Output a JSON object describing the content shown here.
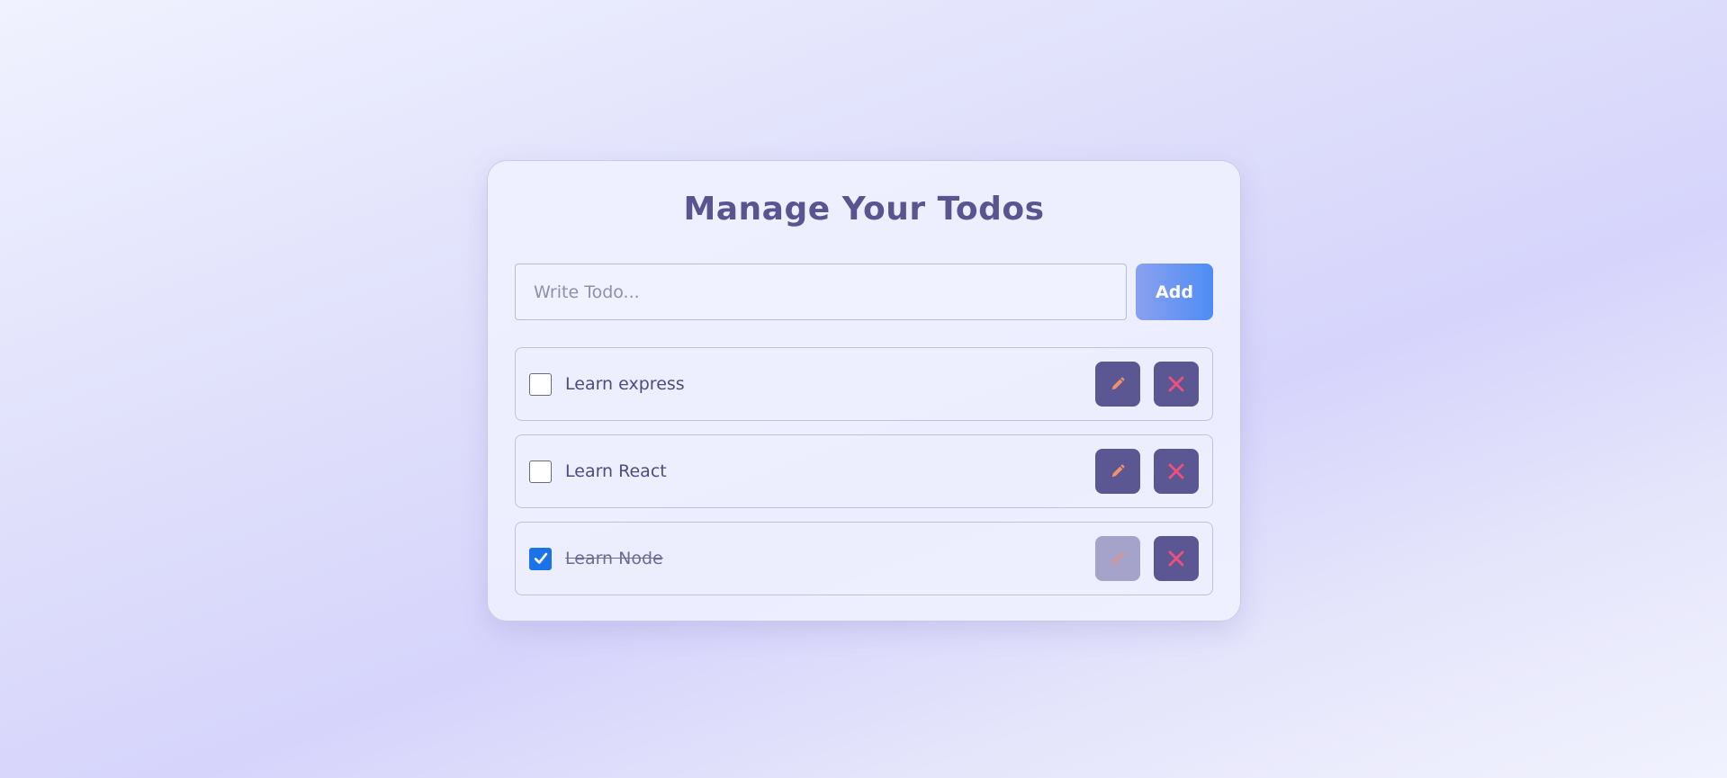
{
  "title": "Manage Your Todos",
  "input": {
    "placeholder": "Write Todo...",
    "value": ""
  },
  "add_label": "Add",
  "todos": [
    {
      "text": "Learn express",
      "completed": false
    },
    {
      "text": "Learn React",
      "completed": false
    },
    {
      "text": "Learn Node",
      "completed": true
    }
  ],
  "icons": {
    "edit": "pencil-icon",
    "delete": "close-icon",
    "checked": "checkmark-icon"
  },
  "colors": {
    "accent": "#5b5792",
    "edit_icon": "#f2906a",
    "delete_icon": "#f0507e",
    "checkbox_checked": "#1a73e8"
  }
}
